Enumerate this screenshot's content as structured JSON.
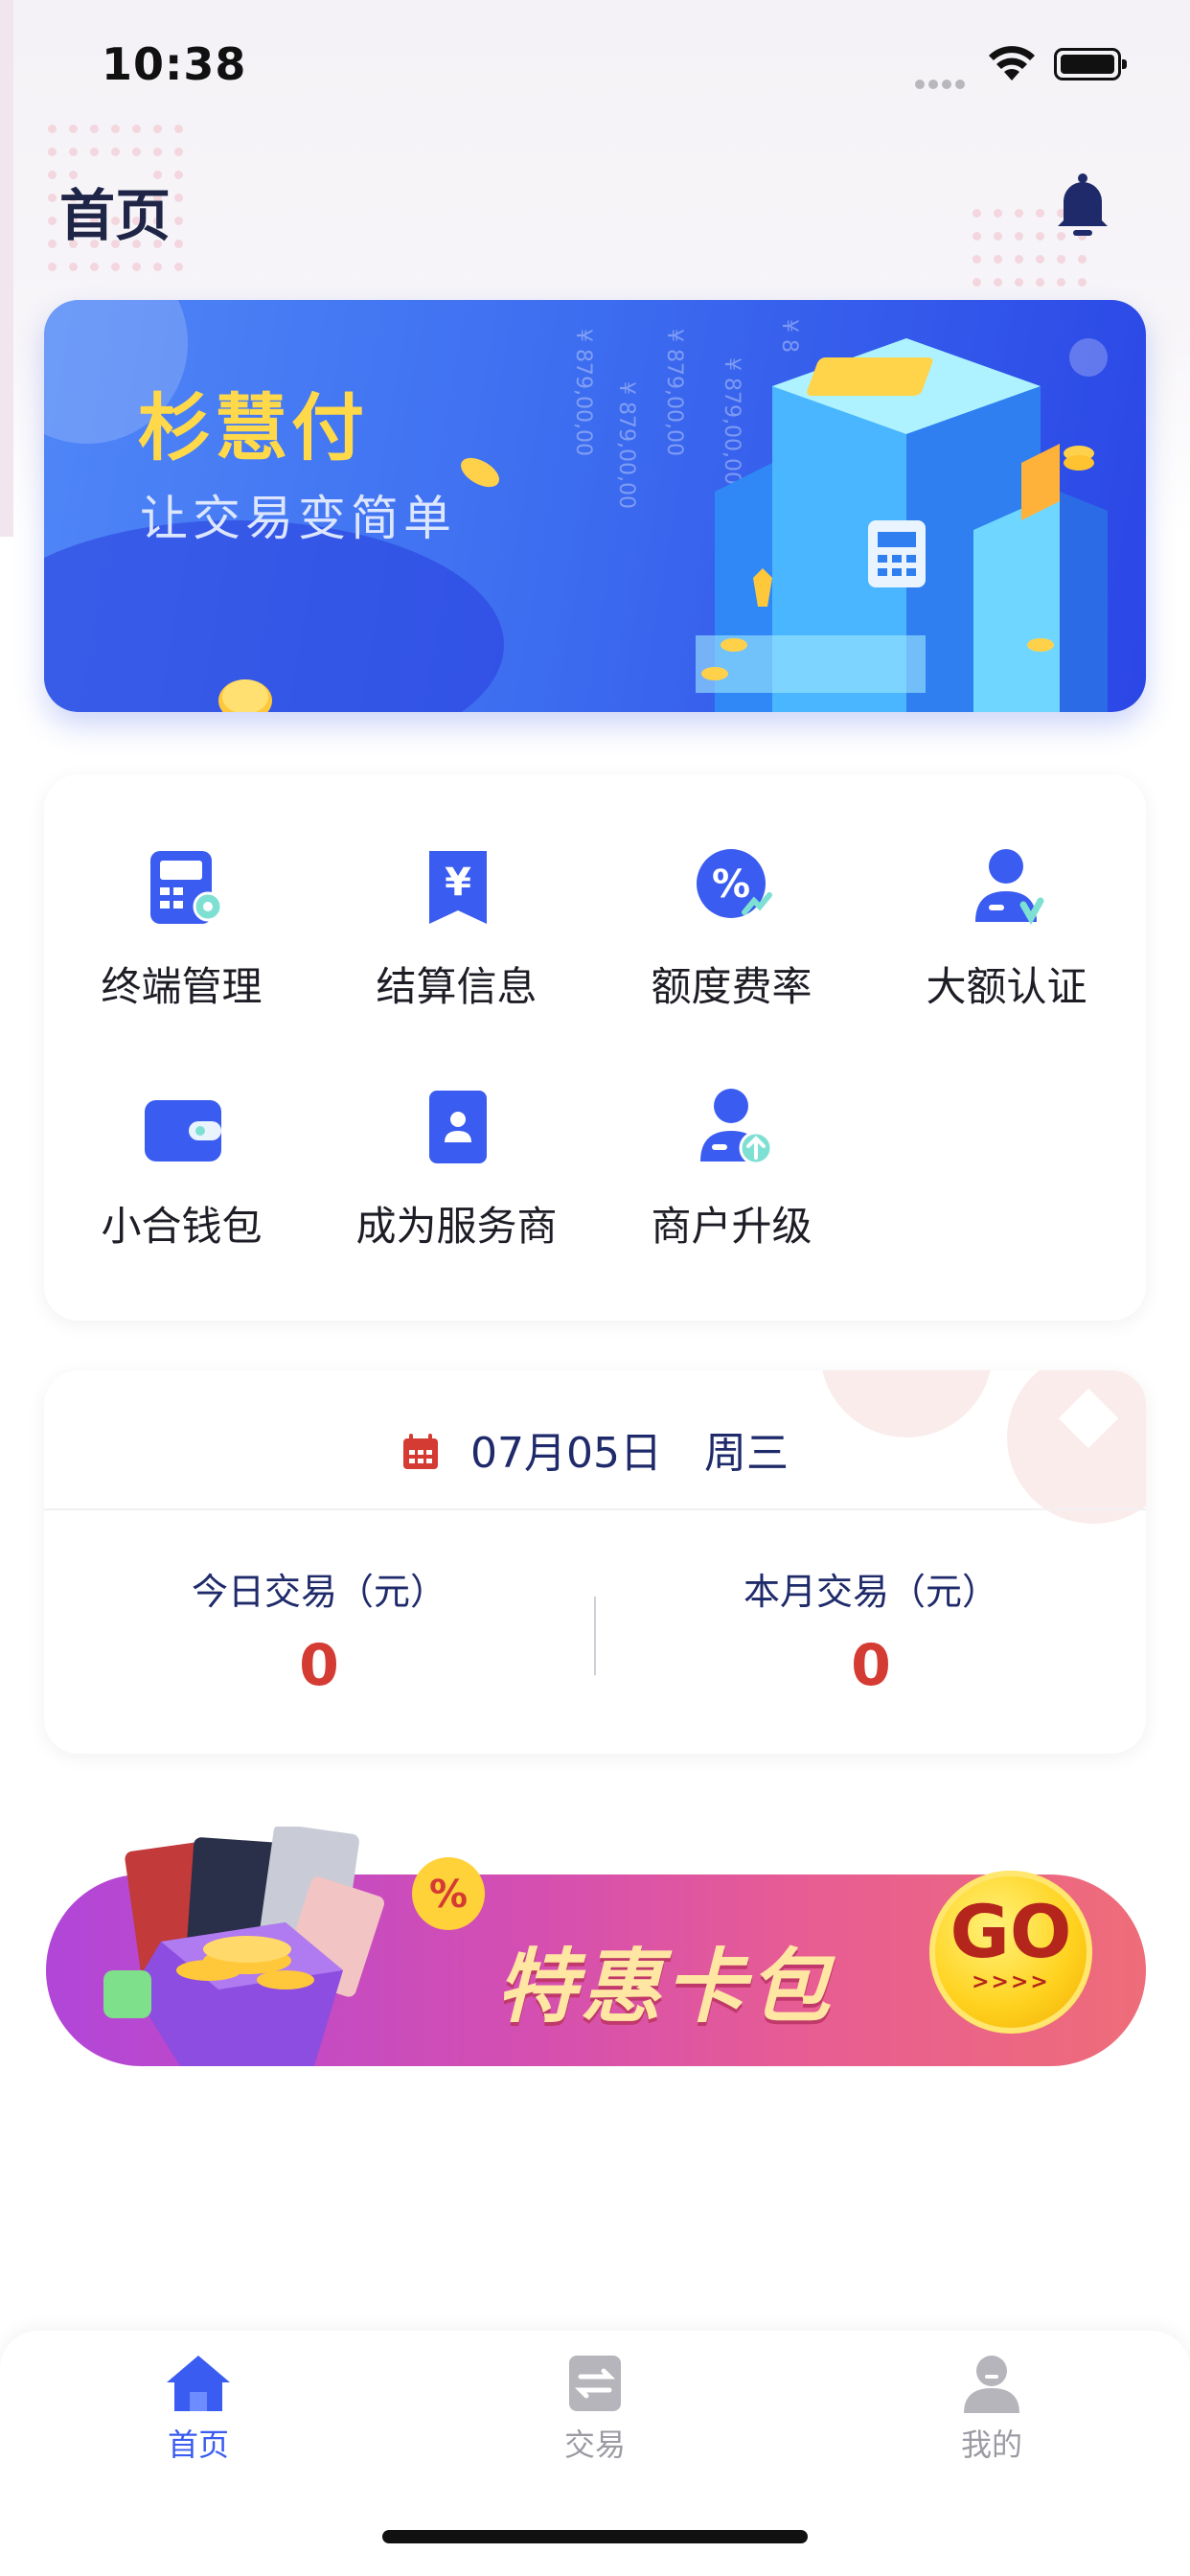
{
  "status_bar": {
    "time": "10:38"
  },
  "header": {
    "title": "首页"
  },
  "banner": {
    "title": "杉慧付",
    "subtitle": "让交易变简单",
    "money_texts": [
      "¥ 879,00,00",
      "¥ 879,00,00",
      "¥ 879,00,00",
      "¥ 879,00,00",
      "¥ 8"
    ]
  },
  "menu": {
    "items": [
      {
        "label": "终端管理",
        "icon": "terminal-icon"
      },
      {
        "label": "结算信息",
        "icon": "settlement-icon"
      },
      {
        "label": "额度费率",
        "icon": "rate-icon"
      },
      {
        "label": "大额认证",
        "icon": "verify-icon"
      },
      {
        "label": "小合钱包",
        "icon": "wallet-icon"
      },
      {
        "label": "成为服务商",
        "icon": "provider-icon"
      },
      {
        "label": "商户升级",
        "icon": "upgrade-icon"
      }
    ]
  },
  "transactions": {
    "date": "07月05日",
    "weekday": "周三",
    "today_label": "今日交易（元）",
    "today_value": "0",
    "month_label": "本月交易（元）",
    "month_value": "0"
  },
  "promo": {
    "text": "特惠卡包",
    "go": "GO",
    "arrows": ">>>>"
  },
  "tabbar": {
    "tabs": [
      {
        "label": "首页",
        "active": true
      },
      {
        "label": "交易",
        "active": false
      },
      {
        "label": "我的",
        "active": false
      }
    ]
  },
  "colors": {
    "brand_blue": "#3a5cf0",
    "accent_red": "#d43b33",
    "tab_inactive": "#9b9ba3",
    "banner_title": "#ffd94a"
  }
}
